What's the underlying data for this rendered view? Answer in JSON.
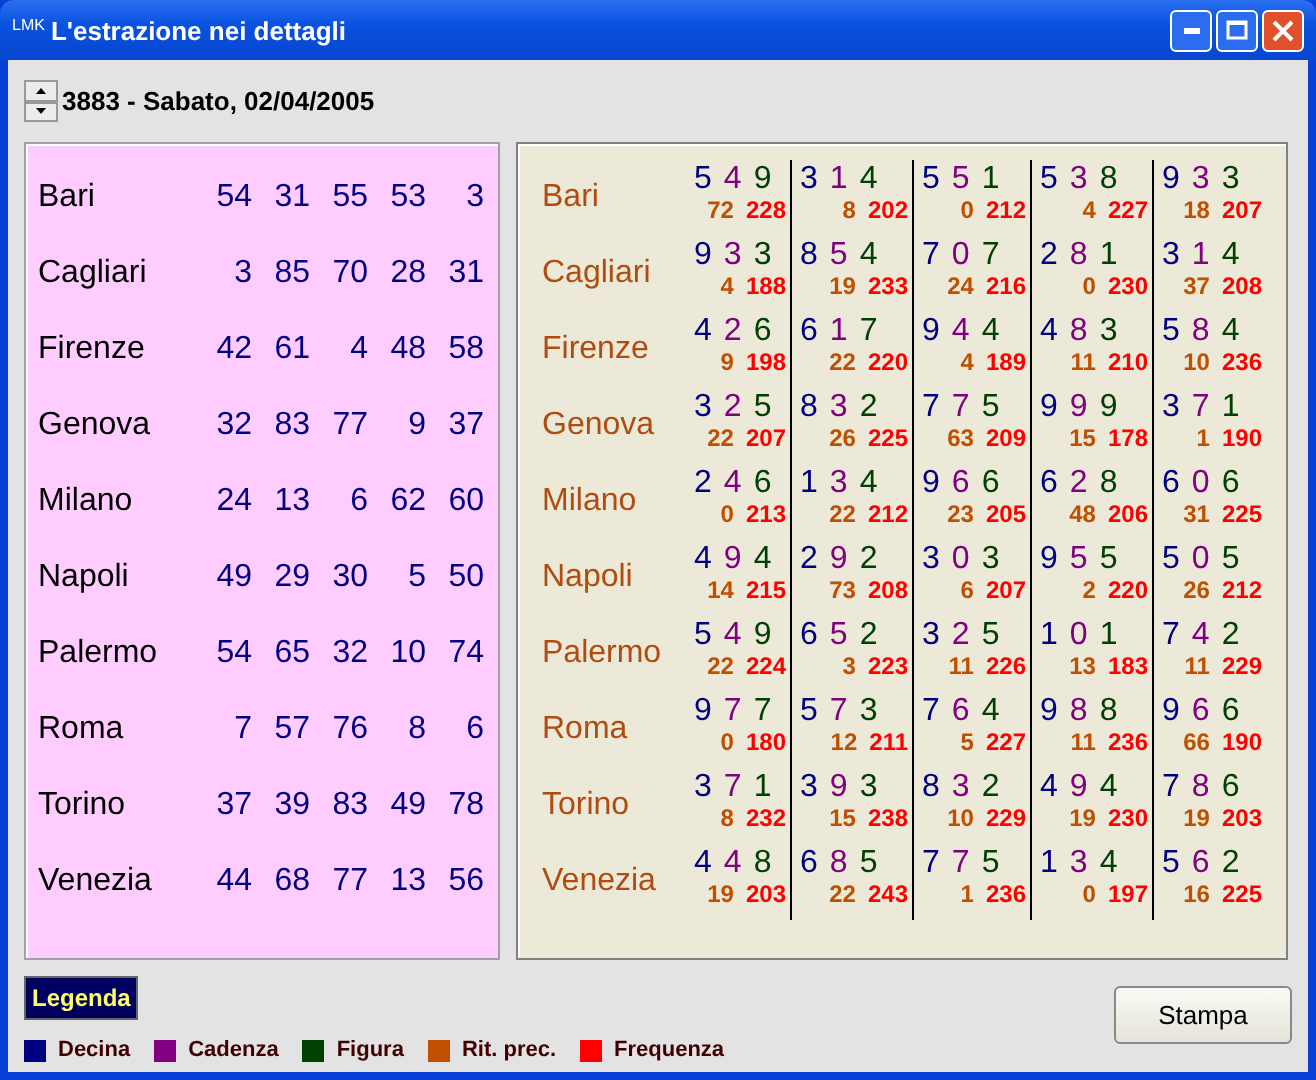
{
  "window": {
    "app_icon": "LMK",
    "title": "L'estrazione nei dettagli"
  },
  "draw": {
    "label": "3883 - Sabato, 02/04/2005"
  },
  "results": [
    {
      "city": "Bari",
      "numbers": [
        "54",
        "31",
        "55",
        "53",
        "3"
      ]
    },
    {
      "city": "Cagliari",
      "numbers": [
        "3",
        "85",
        "70",
        "28",
        "31"
      ]
    },
    {
      "city": "Firenze",
      "numbers": [
        "42",
        "61",
        "4",
        "48",
        "58"
      ]
    },
    {
      "city": "Genova",
      "numbers": [
        "32",
        "83",
        "77",
        "9",
        "37"
      ]
    },
    {
      "city": "Milano",
      "numbers": [
        "24",
        "13",
        "6",
        "62",
        "60"
      ]
    },
    {
      "city": "Napoli",
      "numbers": [
        "49",
        "29",
        "30",
        "5",
        "50"
      ]
    },
    {
      "city": "Palermo",
      "numbers": [
        "54",
        "65",
        "32",
        "10",
        "74"
      ]
    },
    {
      "city": "Roma",
      "numbers": [
        "7",
        "57",
        "76",
        "8",
        "6"
      ]
    },
    {
      "city": "Torino",
      "numbers": [
        "37",
        "39",
        "83",
        "49",
        "78"
      ]
    },
    {
      "city": "Venezia",
      "numbers": [
        "44",
        "68",
        "77",
        "13",
        "56"
      ]
    }
  ],
  "details": [
    {
      "city": "Bari",
      "cells": [
        {
          "digits": [
            "5",
            "4",
            "9"
          ],
          "ritardo": "72",
          "frequenza": "228"
        },
        {
          "digits": [
            "3",
            "1",
            "4"
          ],
          "ritardo": "8",
          "frequenza": "202"
        },
        {
          "digits": [
            "5",
            "5",
            "1"
          ],
          "ritardo": "0",
          "frequenza": "212"
        },
        {
          "digits": [
            "5",
            "3",
            "8"
          ],
          "ritardo": "4",
          "frequenza": "227"
        },
        {
          "digits": [
            "9",
            "3",
            "3"
          ],
          "ritardo": "18",
          "frequenza": "207"
        }
      ]
    },
    {
      "city": "Cagliari",
      "cells": [
        {
          "digits": [
            "9",
            "3",
            "3"
          ],
          "ritardo": "4",
          "frequenza": "188"
        },
        {
          "digits": [
            "8",
            "5",
            "4"
          ],
          "ritardo": "19",
          "frequenza": "233"
        },
        {
          "digits": [
            "7",
            "0",
            "7"
          ],
          "ritardo": "24",
          "frequenza": "216"
        },
        {
          "digits": [
            "2",
            "8",
            "1"
          ],
          "ritardo": "0",
          "frequenza": "230"
        },
        {
          "digits": [
            "3",
            "1",
            "4"
          ],
          "ritardo": "37",
          "frequenza": "208"
        }
      ]
    },
    {
      "city": "Firenze",
      "cells": [
        {
          "digits": [
            "4",
            "2",
            "6"
          ],
          "ritardo": "9",
          "frequenza": "198"
        },
        {
          "digits": [
            "6",
            "1",
            "7"
          ],
          "ritardo": "22",
          "frequenza": "220"
        },
        {
          "digits": [
            "9",
            "4",
            "4"
          ],
          "ritardo": "4",
          "frequenza": "189"
        },
        {
          "digits": [
            "4",
            "8",
            "3"
          ],
          "ritardo": "11",
          "frequenza": "210"
        },
        {
          "digits": [
            "5",
            "8",
            "4"
          ],
          "ritardo": "10",
          "frequenza": "236"
        }
      ]
    },
    {
      "city": "Genova",
      "cells": [
        {
          "digits": [
            "3",
            "2",
            "5"
          ],
          "ritardo": "22",
          "frequenza": "207"
        },
        {
          "digits": [
            "8",
            "3",
            "2"
          ],
          "ritardo": "26",
          "frequenza": "225"
        },
        {
          "digits": [
            "7",
            "7",
            "5"
          ],
          "ritardo": "63",
          "frequenza": "209"
        },
        {
          "digits": [
            "9",
            "9",
            "9"
          ],
          "ritardo": "15",
          "frequenza": "178"
        },
        {
          "digits": [
            "3",
            "7",
            "1"
          ],
          "ritardo": "1",
          "frequenza": "190"
        }
      ]
    },
    {
      "city": "Milano",
      "cells": [
        {
          "digits": [
            "2",
            "4",
            "6"
          ],
          "ritardo": "0",
          "frequenza": "213"
        },
        {
          "digits": [
            "1",
            "3",
            "4"
          ],
          "ritardo": "22",
          "frequenza": "212"
        },
        {
          "digits": [
            "9",
            "6",
            "6"
          ],
          "ritardo": "23",
          "frequenza": "205"
        },
        {
          "digits": [
            "6",
            "2",
            "8"
          ],
          "ritardo": "48",
          "frequenza": "206"
        },
        {
          "digits": [
            "6",
            "0",
            "6"
          ],
          "ritardo": "31",
          "frequenza": "225"
        }
      ]
    },
    {
      "city": "Napoli",
      "cells": [
        {
          "digits": [
            "4",
            "9",
            "4"
          ],
          "ritardo": "14",
          "frequenza": "215"
        },
        {
          "digits": [
            "2",
            "9",
            "2"
          ],
          "ritardo": "73",
          "frequenza": "208"
        },
        {
          "digits": [
            "3",
            "0",
            "3"
          ],
          "ritardo": "6",
          "frequenza": "207"
        },
        {
          "digits": [
            "9",
            "5",
            "5"
          ],
          "ritardo": "2",
          "frequenza": "220"
        },
        {
          "digits": [
            "5",
            "0",
            "5"
          ],
          "ritardo": "26",
          "frequenza": "212"
        }
      ]
    },
    {
      "city": "Palermo",
      "cells": [
        {
          "digits": [
            "5",
            "4",
            "9"
          ],
          "ritardo": "22",
          "frequenza": "224"
        },
        {
          "digits": [
            "6",
            "5",
            "2"
          ],
          "ritardo": "3",
          "frequenza": "223"
        },
        {
          "digits": [
            "3",
            "2",
            "5"
          ],
          "ritardo": "11",
          "frequenza": "226"
        },
        {
          "digits": [
            "1",
            "0",
            "1"
          ],
          "ritardo": "13",
          "frequenza": "183"
        },
        {
          "digits": [
            "7",
            "4",
            "2"
          ],
          "ritardo": "11",
          "frequenza": "229"
        }
      ]
    },
    {
      "city": "Roma",
      "cells": [
        {
          "digits": [
            "9",
            "7",
            "7"
          ],
          "ritardo": "0",
          "frequenza": "180"
        },
        {
          "digits": [
            "5",
            "7",
            "3"
          ],
          "ritardo": "12",
          "frequenza": "211"
        },
        {
          "digits": [
            "7",
            "6",
            "4"
          ],
          "ritardo": "5",
          "frequenza": "227"
        },
        {
          "digits": [
            "9",
            "8",
            "8"
          ],
          "ritardo": "11",
          "frequenza": "236"
        },
        {
          "digits": [
            "9",
            "6",
            "6"
          ],
          "ritardo": "66",
          "frequenza": "190"
        }
      ]
    },
    {
      "city": "Torino",
      "cells": [
        {
          "digits": [
            "3",
            "7",
            "1"
          ],
          "ritardo": "8",
          "frequenza": "232"
        },
        {
          "digits": [
            "3",
            "9",
            "3"
          ],
          "ritardo": "15",
          "frequenza": "238"
        },
        {
          "digits": [
            "8",
            "3",
            "2"
          ],
          "ritardo": "10",
          "frequenza": "229"
        },
        {
          "digits": [
            "4",
            "9",
            "4"
          ],
          "ritardo": "19",
          "frequenza": "230"
        },
        {
          "digits": [
            "7",
            "8",
            "6"
          ],
          "ritardo": "19",
          "frequenza": "203"
        }
      ]
    },
    {
      "city": "Venezia",
      "cells": [
        {
          "digits": [
            "4",
            "4",
            "8"
          ],
          "ritardo": "19",
          "frequenza": "203"
        },
        {
          "digits": [
            "6",
            "8",
            "5"
          ],
          "ritardo": "22",
          "frequenza": "243"
        },
        {
          "digits": [
            "7",
            "7",
            "5"
          ],
          "ritardo": "1",
          "frequenza": "236"
        },
        {
          "digits": [
            "1",
            "3",
            "4"
          ],
          "ritardo": "0",
          "frequenza": "197"
        },
        {
          "digits": [
            "5",
            "6",
            "2"
          ],
          "ritardo": "16",
          "frequenza": "225"
        }
      ]
    }
  ],
  "legend": {
    "title": "Legenda",
    "items": [
      {
        "label": "Decina",
        "color": "#000080"
      },
      {
        "label": "Cadenza",
        "color": "#800080"
      },
      {
        "label": "Figura",
        "color": "#004000"
      },
      {
        "label": "Rit. prec.",
        "color": "#c05000"
      },
      {
        "label": "Frequenza",
        "color": "#ff0000"
      }
    ]
  },
  "buttons": [
    {
      "label": "Stampa"
    }
  ]
}
